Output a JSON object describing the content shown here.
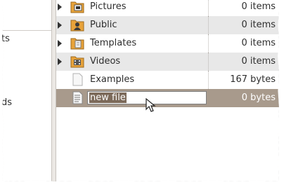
{
  "sidebar": {
    "items": [
      {
        "label": "ts"
      },
      {
        "label": "ds"
      }
    ]
  },
  "files": [
    {
      "name": "Pictures",
      "size": "0 items",
      "type": "folde",
      "icon": "folder-pictures-icon",
      "expandable": true
    },
    {
      "name": "Public",
      "size": "0 items",
      "type": "folde",
      "icon": "folder-public-icon",
      "expandable": true
    },
    {
      "name": "Templates",
      "size": "0 items",
      "type": "folde",
      "icon": "folder-templates-icon",
      "expandable": true
    },
    {
      "name": "Videos",
      "size": "0 items",
      "type": "folde",
      "icon": "folder-videos-icon",
      "expandable": true
    },
    {
      "name": "Examples",
      "size": "167 bytes",
      "type": "desk",
      "icon": "desktop-file-icon",
      "expandable": false
    },
    {
      "name": "new file",
      "size": "0 bytes",
      "type": "plair",
      "icon": "text-file-icon",
      "expandable": false,
      "selected": true,
      "renaming": true
    }
  ],
  "colors": {
    "selection": "#a89a8c",
    "folder": "#e8a33a",
    "rename_highlight": "#7c6a5a"
  }
}
